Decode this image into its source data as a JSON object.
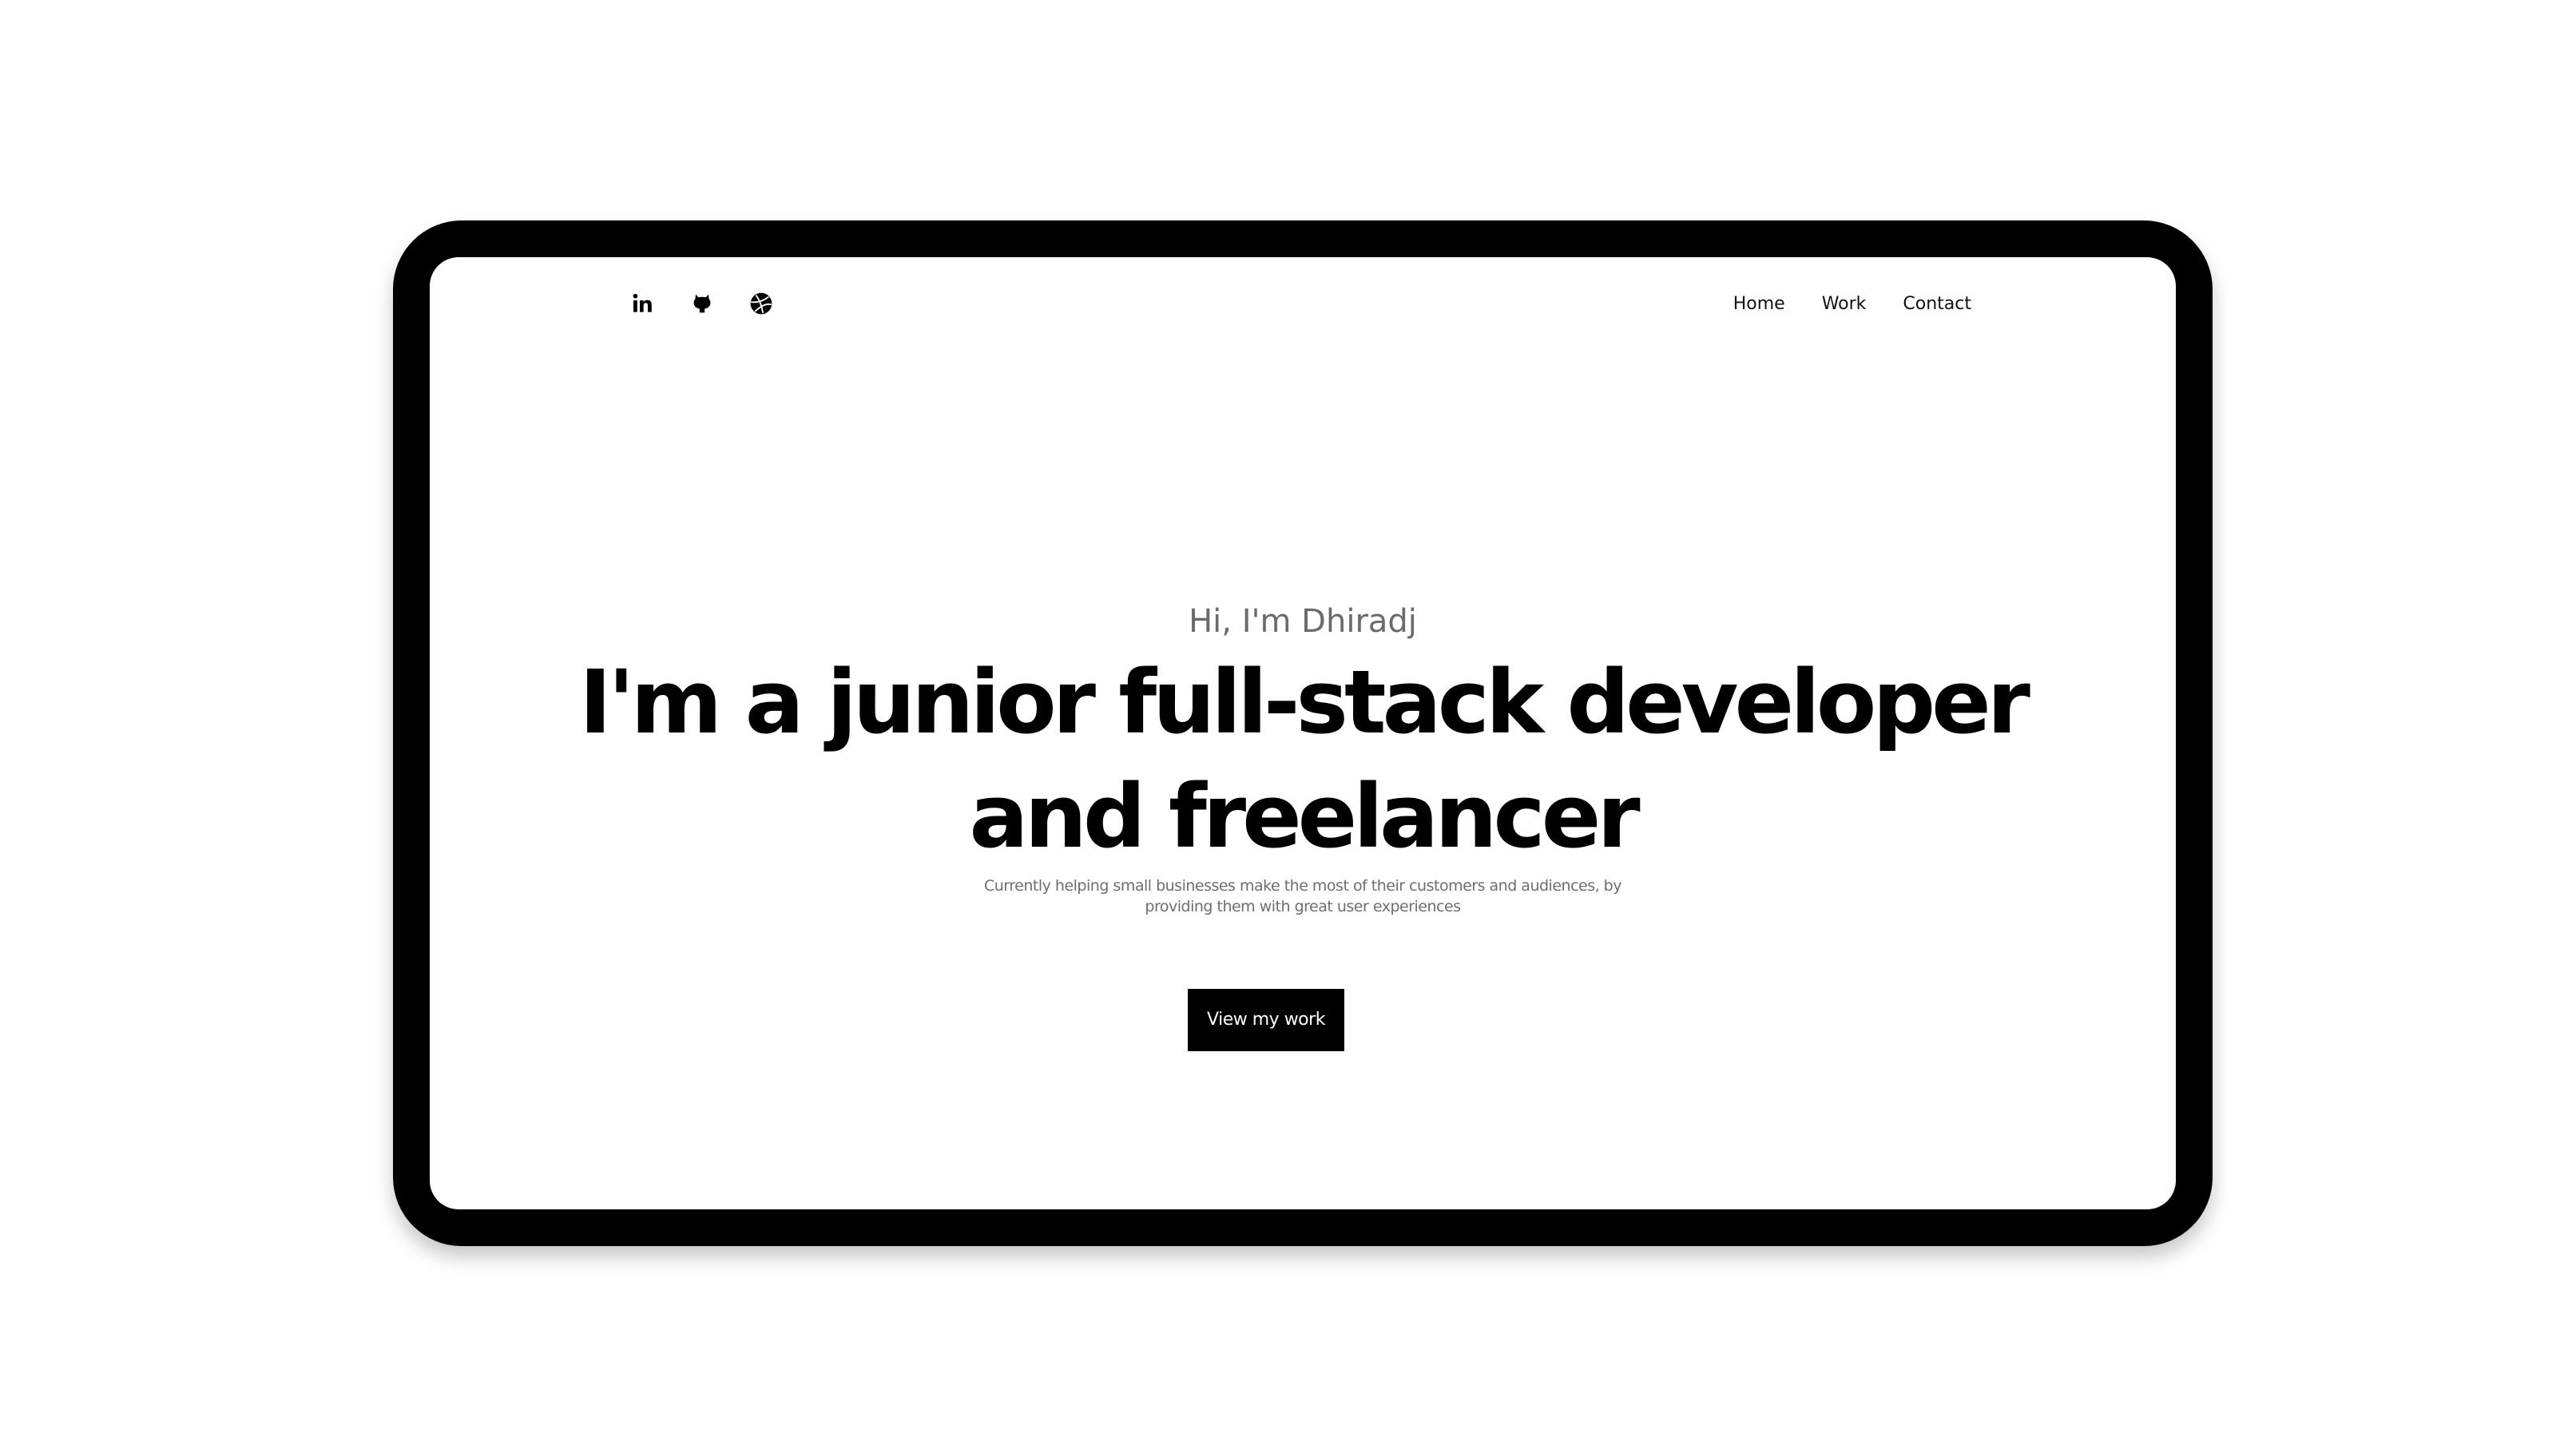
{
  "social": [
    {
      "name": "linkedin-icon",
      "label": "in"
    },
    {
      "name": "github-icon"
    },
    {
      "name": "dribbble-icon"
    }
  ],
  "nav": {
    "home": "Home",
    "work": "Work",
    "contact": "Contact"
  },
  "hero": {
    "greeting": "Hi, I'm Dhiradj",
    "headline_line1": "I'm a junior full-stack developer",
    "headline_line2": "and freelancer",
    "subtext": "Currently helping small businesses make the most of their customers and audiences, by providing them with great user experiences",
    "cta_label": "View my work"
  },
  "colors": {
    "device_frame": "#000000",
    "background": "#ffffff",
    "greeting_text": "#6b6b6b",
    "headline_text": "#000000",
    "cta_background": "#000000",
    "cta_text": "#ffffff"
  }
}
